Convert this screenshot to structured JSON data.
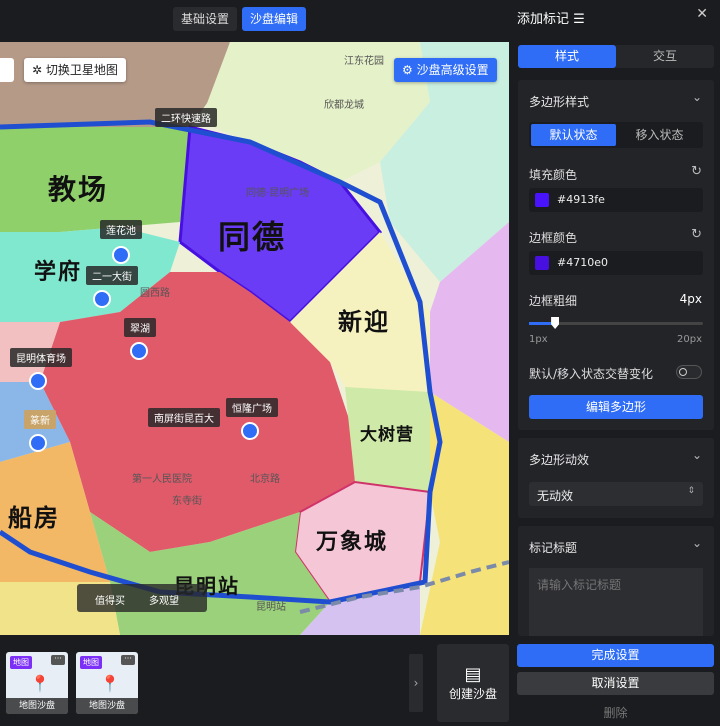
{
  "topbar": {
    "tab_basic": "基础设置",
    "tab_sand": "沙盘编辑"
  },
  "map": {
    "satellite_btn": "切换卫星地图",
    "advanced_btn": "沙盘高级设置",
    "region_labels": [
      "教场",
      "学府",
      "同德",
      "新迎",
      "大树营",
      "船房",
      "万象城",
      "昆明站"
    ],
    "tags": [
      "二环快速路",
      "莲花池",
      "二一大街",
      "翠湖",
      "昆明体育场",
      "篆新",
      "南屏街昆百大",
      "恒隆广场"
    ],
    "streets": [
      "江东花园",
      "欣都龙城",
      "同德·昆明广场",
      "圆西路",
      "第一人民医院",
      "北京路",
      "东寺街",
      "昆明站"
    ],
    "chips": [
      "值得买",
      "多观望"
    ],
    "thumbnails": [
      {
        "badge": "地图",
        "name": "地图沙盘"
      },
      {
        "badge": "地图",
        "name": "地图沙盘"
      }
    ],
    "create_label": "创建沙盘",
    "fill_color": "#4913fe",
    "border_color": "#4710e0"
  },
  "panel": {
    "title": "添加标记",
    "seg_style": "样式",
    "seg_interact": "交互",
    "polygon_style": "多边形样式",
    "state_default": "默认状态",
    "state_hover": "移入状态",
    "fill_label": "填充颜色",
    "fill_hex": "#4913fe",
    "border_label": "边框颜色",
    "border_hex": "#4710e0",
    "width_label": "边框粗细",
    "width_value": "4px",
    "slider_min": "1px",
    "slider_max": "20px",
    "slider_level": 0.15,
    "alt_toggle_label": "默认/移入状态交替变化",
    "edit_polygon": "编辑多边形",
    "anim_label": "多边形动效",
    "anim_value": "无动效",
    "marker_title_label": "标记标题",
    "marker_title_placeholder": "请输入标记标题",
    "done_btn": "完成设置",
    "cancel_btn": "取消设置",
    "delete_btn": "删除"
  }
}
